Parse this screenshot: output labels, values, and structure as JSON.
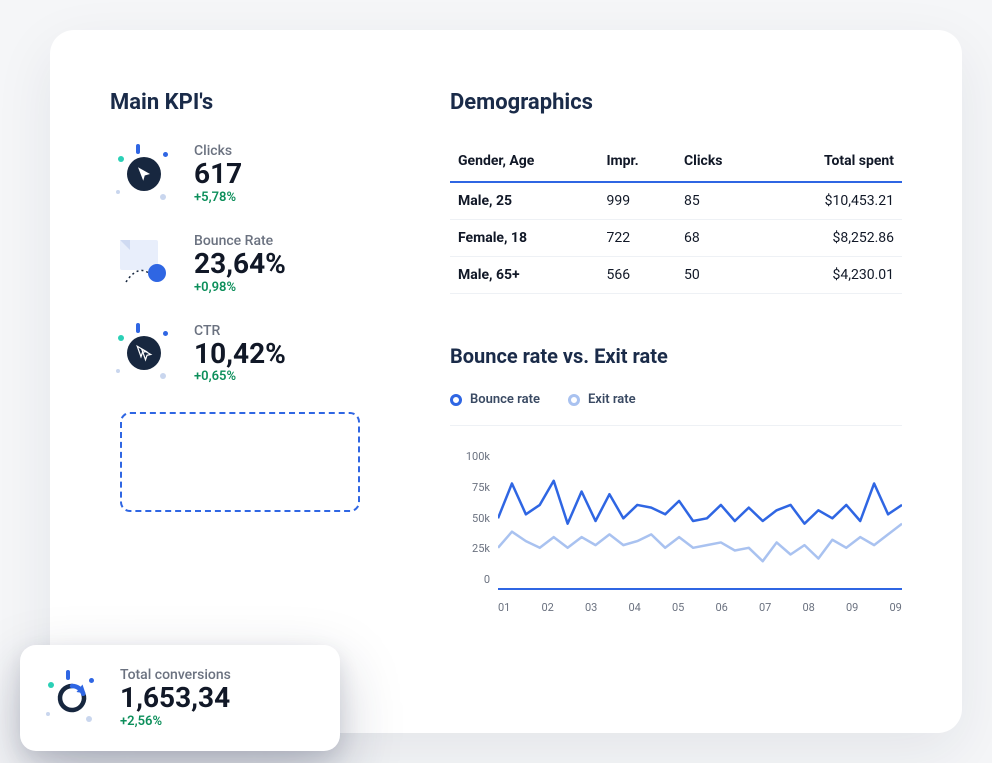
{
  "kpi_title": "Main KPI's",
  "kpis": [
    {
      "label": "Clicks",
      "value": "617",
      "change": "+5,78%"
    },
    {
      "label": "Bounce Rate",
      "value": "23,64%",
      "change": "+0,98%"
    },
    {
      "label": "CTR",
      "value": "10,42%",
      "change": "+0,65%"
    }
  ],
  "conversions": {
    "label": "Total conversions",
    "value": "1,653,34",
    "change": "+2,56%"
  },
  "demographics": {
    "title": "Demographics",
    "headers": [
      "Gender, Age",
      "Impr.",
      "Clicks",
      "Total spent"
    ],
    "rows": [
      [
        "Male, 25",
        "999",
        "85",
        "$10,453.21"
      ],
      [
        "Female, 18",
        "722",
        "68",
        "$8,252.86"
      ],
      [
        "Male, 65+",
        "566",
        "50",
        "$4,230.01"
      ]
    ]
  },
  "chart": {
    "title": "Bounce rate vs. Exit rate",
    "legend": [
      {
        "name": "Bounce rate",
        "color": "#2f66e3"
      },
      {
        "name": "Exit rate",
        "color": "#a9c2f0"
      }
    ],
    "y_ticks": [
      "100k",
      "75k",
      "50k",
      "25k",
      "0"
    ],
    "x_ticks": [
      "01",
      "02",
      "03",
      "04",
      "05",
      "06",
      "07",
      "08",
      "09",
      "09"
    ]
  },
  "chart_data": {
    "type": "line",
    "title": "Bounce rate vs. Exit rate",
    "xlabel": "",
    "ylabel": "",
    "ylim": [
      0,
      100000
    ],
    "categories": [
      "01",
      "02",
      "03",
      "04",
      "05",
      "06",
      "07",
      "08",
      "09",
      "09"
    ],
    "series": [
      {
        "name": "Bounce rate",
        "color": "#2f66e3",
        "values": [
          52000,
          78000,
          55000,
          62000,
          80000,
          48000,
          72000,
          50000,
          70000,
          52000,
          62000,
          60000,
          55000,
          65000,
          50000,
          52000,
          62000,
          50000,
          60000,
          50000,
          58000,
          62000,
          48000,
          58000,
          52000,
          62000,
          50000,
          78000,
          55000,
          62000
        ]
      },
      {
        "name": "Exit rate",
        "color": "#a9c2f0",
        "values": [
          30000,
          42000,
          35000,
          30000,
          38000,
          30000,
          38000,
          32000,
          40000,
          32000,
          35000,
          40000,
          30000,
          38000,
          30000,
          32000,
          34000,
          28000,
          30000,
          20000,
          34000,
          25000,
          32000,
          22000,
          36000,
          30000,
          38000,
          32000,
          40000,
          48000
        ]
      }
    ]
  }
}
